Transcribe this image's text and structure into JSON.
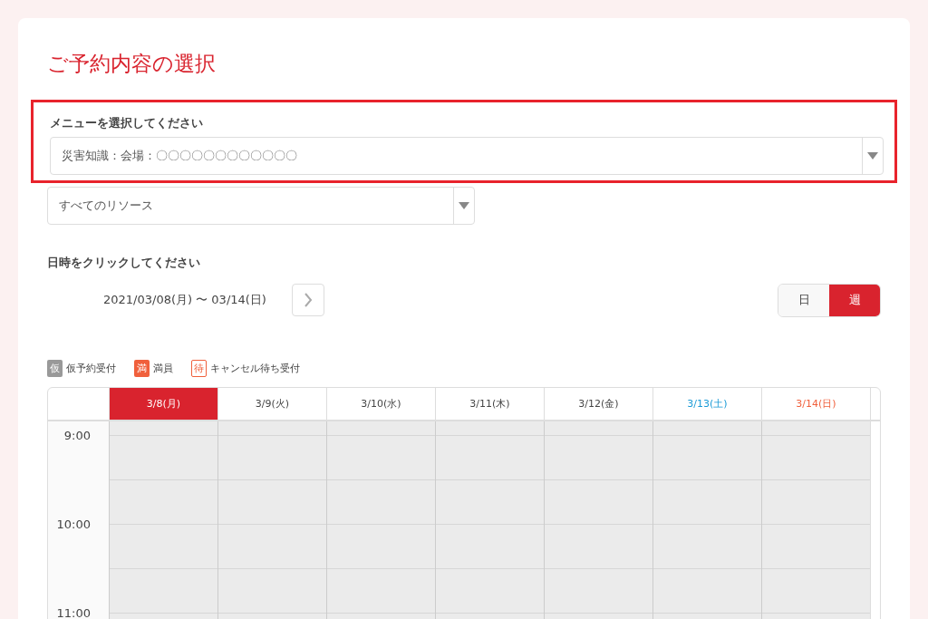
{
  "title": "ご予約内容の選択",
  "menu": {
    "label": "メニューを選択してください",
    "value": "災害知識：会場：〇〇〇〇〇〇〇〇〇〇〇〇",
    "highlighted": true
  },
  "resource": {
    "value": "すべてのリソース"
  },
  "datetime": {
    "label": "日時をクリックしてください",
    "range": "2021/03/08(月) 〜 03/14(日)"
  },
  "view_toggle": [
    {
      "label": "日",
      "selected": false
    },
    {
      "label": "週",
      "selected": true
    }
  ],
  "legend": [
    {
      "kind": "tentative",
      "badge": "仮",
      "label": "仮予約受付"
    },
    {
      "kind": "full",
      "badge": "満",
      "label": "満員"
    },
    {
      "kind": "waitlist",
      "badge": "待",
      "label": "キャンセル待ち受付"
    }
  ],
  "days": [
    {
      "label": "3/8(月)",
      "kind": "weekday",
      "selected": true
    },
    {
      "label": "3/9(火)",
      "kind": "weekday",
      "selected": false
    },
    {
      "label": "3/10(水)",
      "kind": "weekday",
      "selected": false
    },
    {
      "label": "3/11(木)",
      "kind": "weekday",
      "selected": false
    },
    {
      "label": "3/12(金)",
      "kind": "weekday",
      "selected": false
    },
    {
      "label": "3/13(土)",
      "kind": "saturday",
      "selected": false
    },
    {
      "label": "3/14(日)",
      "kind": "sunday",
      "selected": false
    }
  ],
  "times": [
    "9:00",
    "10:00",
    "11:00"
  ]
}
